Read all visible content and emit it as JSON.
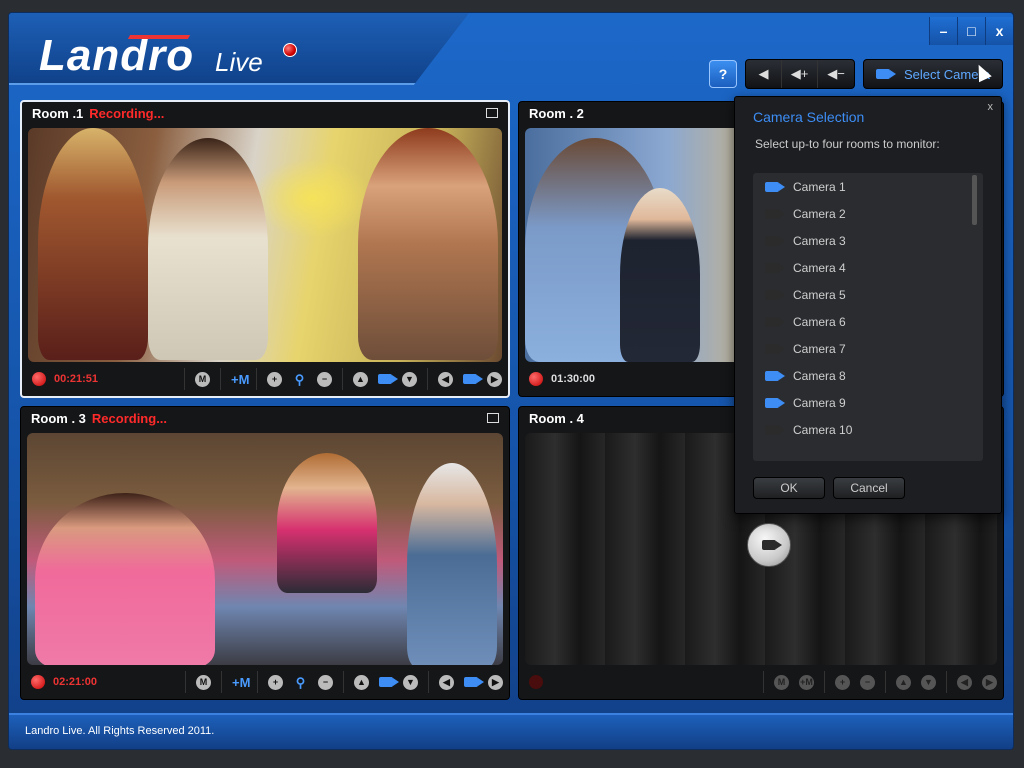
{
  "window_controls": {
    "minimize": "–",
    "maximize": "□",
    "close": "x"
  },
  "logo": {
    "brand": "Landro",
    "product": "Live"
  },
  "toolbar": {
    "help_icon": "help-icon",
    "mute_label": "◀",
    "vol_up_label": "◀+",
    "vol_down_label": "◀−",
    "select_camera_label": "Select Camera"
  },
  "rooms": [
    {
      "title": "Room .1",
      "status": "Recording...",
      "timer": "00:21:51"
    },
    {
      "title": "Room . 2",
      "status": "",
      "timer": "01:30:00"
    },
    {
      "title": "Room . 3",
      "status": "Recording...",
      "timer": "02:21:00"
    },
    {
      "title": "Room . 4",
      "status": "",
      "timer": ""
    }
  ],
  "controls": {
    "mute_m": "M",
    "add_m": "+M",
    "zoom_in": "+",
    "zoom_out": "−",
    "up": "▲",
    "down": "▼",
    "left": "◀",
    "right": "▶"
  },
  "camera_popup": {
    "title": "Camera Selection",
    "close": "x",
    "instructions": "Select up-to four rooms to monitor:",
    "cameras": [
      {
        "label": "Camera 1",
        "selected": true
      },
      {
        "label": "Camera 2",
        "selected": false
      },
      {
        "label": "Camera 3",
        "selected": false
      },
      {
        "label": "Camera 4",
        "selected": false
      },
      {
        "label": "Camera 5",
        "selected": false
      },
      {
        "label": "Camera 6",
        "selected": false
      },
      {
        "label": "Camera 7",
        "selected": false
      },
      {
        "label": "Camera 8",
        "selected": true
      },
      {
        "label": "Camera 9",
        "selected": true
      },
      {
        "label": "Camera 10",
        "selected": false
      }
    ],
    "ok_label": "OK",
    "cancel_label": "Cancel"
  },
  "footer": {
    "copyright": "Landro Live. All Rights Reserved 2011."
  },
  "colors": {
    "brand_blue": "#1553a8",
    "accent_blue": "#3d8df5",
    "recording_red": "#ff2a2a"
  }
}
